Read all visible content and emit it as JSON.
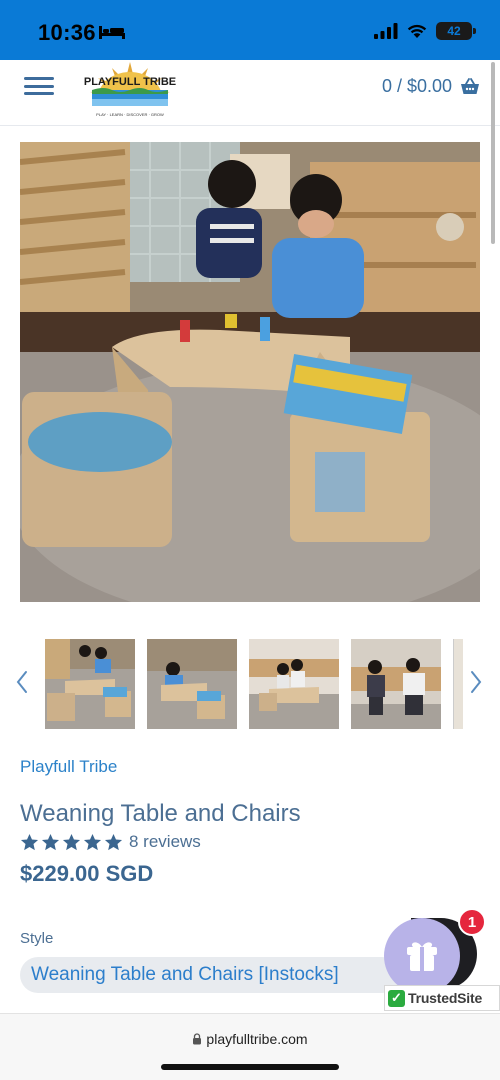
{
  "status_bar": {
    "time": "10:36",
    "battery": "42",
    "icons": [
      "bed-icon",
      "signal-icon",
      "wifi-icon",
      "battery-icon"
    ]
  },
  "header": {
    "menu_icon": "hamburger-menu-icon",
    "logo_text": "PLAYFULL TRIBE",
    "logo_tagline": "PLAY · LEARN · DISCOVER · GROW",
    "cart_text": "0 / $0.00",
    "cart_icon": "shopping-basket-icon"
  },
  "gallery": {
    "hero_alt": "Two children playing at a wooden weaning table with a cushioned chair and a book-holder chair",
    "thumbnail_count": 4,
    "prev_icon": "chevron-left-icon",
    "next_icon": "chevron-right-icon"
  },
  "product": {
    "vendor": "Playfull Tribe",
    "title": "Weaning Table and Chairs",
    "rating": 5,
    "reviews": "8 reviews",
    "price": "$229.00 SGD",
    "style_label": "Style",
    "style_value": "Weaning Table and Chairs [Instocks]"
  },
  "widgets": {
    "gift_icon": "gift-icon",
    "notification_count": "1",
    "trusted_site": "TrustedSite"
  },
  "browser": {
    "url": "playfulltribe.com",
    "lock_icon": "lock-icon"
  },
  "colors": {
    "status_bar": "#0a7ad6",
    "accent": "#2c82c9",
    "title_text": "#4c6f93",
    "price": "#3b6690",
    "star": "#3b6690",
    "gift_bg": "#b8b3e8",
    "badge": "#e5263d",
    "trusted_green": "#2bab3f"
  }
}
